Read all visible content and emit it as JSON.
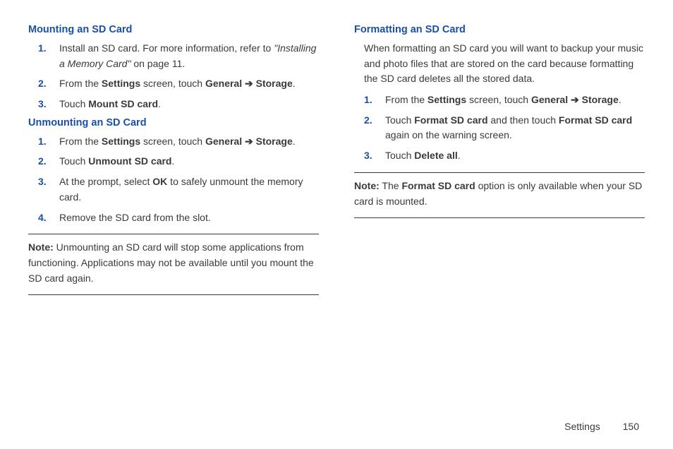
{
  "left": {
    "heading1": "Mounting an SD Card",
    "steps1": [
      {
        "num": "1.",
        "pre": "Install an SD card. For more information, refer to ",
        "ref_italic": "\"Installing a Memory Card\"",
        "post": " on page 11."
      },
      {
        "num": "2.",
        "pre": "From the ",
        "b1": "Settings",
        "mid": " screen, touch ",
        "b2": "General",
        "arrow": " ➔ ",
        "b3": "Storage",
        "post": "."
      },
      {
        "num": "3.",
        "pre": "Touch ",
        "b1": "Mount SD card",
        "post": "."
      }
    ],
    "heading2": "Unmounting an SD Card",
    "steps2": [
      {
        "num": "1.",
        "pre": "From the ",
        "b1": "Settings",
        "mid": " screen, touch ",
        "b2": "General",
        "arrow": " ➔ ",
        "b3": "Storage",
        "post": "."
      },
      {
        "num": "2.",
        "pre": "Touch ",
        "b1": "Unmount SD card",
        "post": "."
      },
      {
        "num": "3.",
        "pre": "At the prompt, select ",
        "b1": "OK",
        "post": " to safely unmount the memory card."
      },
      {
        "num": "4.",
        "pre": "Remove the SD card from the slot.",
        "b1": "",
        "post": ""
      }
    ],
    "note_label": "Note:",
    "note_text": " Unmounting an SD card will stop some applications from functioning. Applications may not be available until you mount the SD card again."
  },
  "right": {
    "heading1": "Formatting an SD Card",
    "intro": "When formatting an SD card you will want to backup your music and photo files that are stored on the card because formatting the SD card deletes all the stored data.",
    "steps1": [
      {
        "num": "1.",
        "pre": "From the ",
        "b1": "Settings",
        "mid": " screen, touch ",
        "b2": "General",
        "arrow": " ➔ ",
        "b3": "Storage",
        "post": "."
      },
      {
        "num": "2.",
        "pre": "Touch ",
        "b1": "Format SD card",
        "mid": " and then touch ",
        "b2": "Format SD card",
        "post": " again on the warning screen."
      },
      {
        "num": "3.",
        "pre": "Touch ",
        "b1": "Delete all",
        "post": "."
      }
    ],
    "note_label": "Note:",
    "note_pre": " The ",
    "note_bold": "Format SD card",
    "note_post": " option is only available when your SD card is mounted."
  },
  "footer": {
    "section": "Settings",
    "page": "150"
  }
}
